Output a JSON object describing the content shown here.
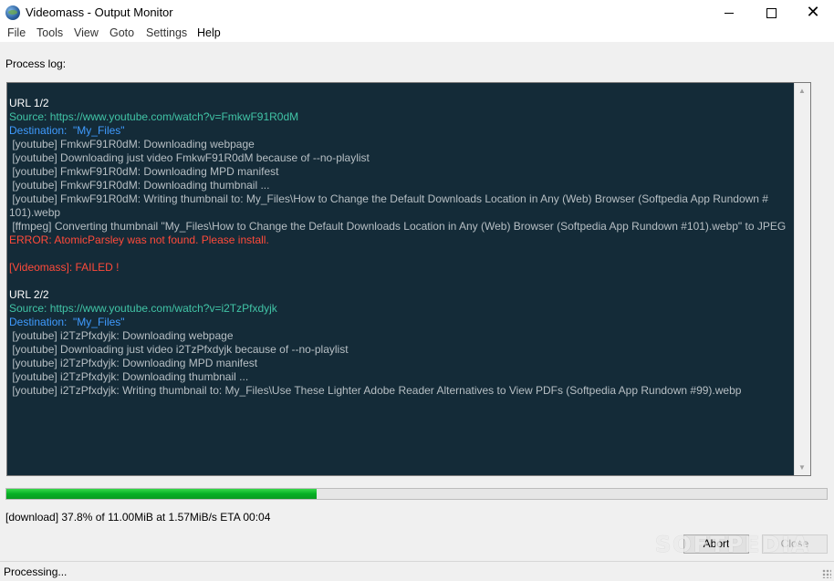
{
  "window": {
    "title": "Videomass - Output Monitor",
    "controls": {
      "minimize": "minimize",
      "maximize": "maximize",
      "close": "✕"
    }
  },
  "menu": {
    "file": "File",
    "tools": "Tools",
    "view": "View",
    "goto": "Goto",
    "settings": "Settings",
    "help": "Help"
  },
  "log_label": "Process log:",
  "log": {
    "lines": [
      {
        "text": "URL 1/2",
        "color": "white"
      },
      {
        "text": "Source: https://www.youtube.com/watch?v=FmkwF91R0dM",
        "color": "green"
      },
      {
        "text": "Destination:  \"My_Files\"",
        "color": "blue"
      },
      {
        "text": " [youtube] FmkwF91R0dM: Downloading webpage",
        "color": "gray"
      },
      {
        "text": " [youtube] Downloading just video FmkwF91R0dM because of --no-playlist",
        "color": "gray"
      },
      {
        "text": " [youtube] FmkwF91R0dM: Downloading MPD manifest",
        "color": "gray"
      },
      {
        "text": " [youtube] FmkwF91R0dM: Downloading thumbnail ...",
        "color": "gray"
      },
      {
        "text": " [youtube] FmkwF91R0dM: Writing thumbnail to: My_Files\\How to Change the Default Downloads Location in Any (Web) Browser (Softpedia App Rundown #\n101).webp",
        "color": "gray"
      },
      {
        "text": " [ffmpeg] Converting thumbnail \"My_Files\\How to Change the Default Downloads Location in Any (Web) Browser (Softpedia App Rundown #101).webp\" to JPEG",
        "color": "gray"
      },
      {
        "text": "ERROR: AtomicParsley was not found. Please install.",
        "color": "red"
      },
      {
        "text": "",
        "color": "blank"
      },
      {
        "text": "[Videomass]: FAILED !",
        "color": "red"
      },
      {
        "text": "",
        "color": "blank"
      },
      {
        "text": "URL 2/2",
        "color": "white"
      },
      {
        "text": "Source: https://www.youtube.com/watch?v=i2TzPfxdyjk",
        "color": "green"
      },
      {
        "text": "Destination:  \"My_Files\"",
        "color": "blue"
      },
      {
        "text": " [youtube] i2TzPfxdyjk: Downloading webpage",
        "color": "gray"
      },
      {
        "text": " [youtube] Downloading just video i2TzPfxdyjk because of --no-playlist",
        "color": "gray"
      },
      {
        "text": " [youtube] i2TzPfxdyjk: Downloading MPD manifest",
        "color": "gray"
      },
      {
        "text": " [youtube] i2TzPfxdyjk: Downloading thumbnail ...",
        "color": "gray"
      },
      {
        "text": " [youtube] i2TzPfxdyjk: Writing thumbnail to: My_Files\\Use These Lighter Adobe Reader Alternatives to View PDFs (Softpedia App Rundown #99).webp",
        "color": "gray"
      }
    ]
  },
  "progress": {
    "percent": 37.8
  },
  "download_status": "[download]  37.8% of 11.00MiB at  1.57MiB/s ETA 00:04",
  "buttons": {
    "abort": "Abort",
    "close": "Close"
  },
  "watermark": "SOFTPEDIA",
  "statusbar": {
    "text": "Processing..."
  },
  "colors": {
    "log_bg": "#142b38",
    "white": "#ffffff",
    "green": "#41c4a6",
    "blue": "#3f9bff",
    "gray": "#b7bfc4",
    "red": "#ff4a3a",
    "progress": "#06b025"
  }
}
